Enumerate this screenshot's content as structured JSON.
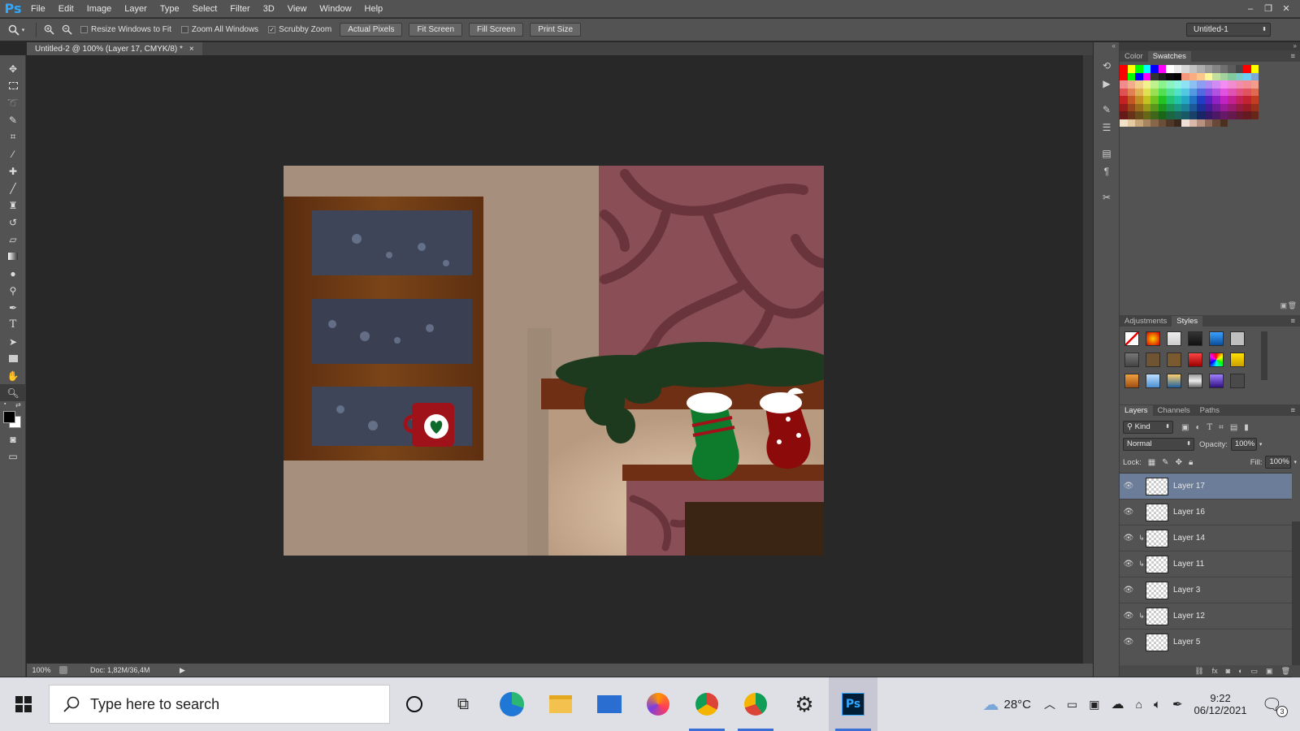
{
  "app": {
    "logo": "Ps"
  },
  "menu": [
    "File",
    "Edit",
    "Image",
    "Layer",
    "Type",
    "Select",
    "Filter",
    "3D",
    "View",
    "Window",
    "Help"
  ],
  "window_controls": {
    "minimize": "–",
    "restore": "❐",
    "close": "✕"
  },
  "options": {
    "resize_windows": "Resize Windows to Fit",
    "zoom_all": "Zoom All Windows",
    "scrubby_zoom": "Scrubby Zoom",
    "scrubby_checked": "✓",
    "actual_pixels": "Actual Pixels",
    "fit_screen": "Fit Screen",
    "fill_screen": "Fill Screen",
    "print_size": "Print Size",
    "workspace_doc": "Untitled-1"
  },
  "document": {
    "tab_title": "Untitled-2 @ 100% (Layer 17, CMYK/8) *",
    "tab_close": "×",
    "zoom": "100%",
    "doc_size": "Doc: 1,82M/36,4M"
  },
  "panels": {
    "color_tabs": [
      "Color",
      "Swatches"
    ],
    "adj_tabs": [
      "Adjustments",
      "Styles"
    ],
    "layer_tabs": [
      "Layers",
      "Channels",
      "Paths"
    ],
    "kind": "Kind",
    "blend_mode": "Normal",
    "opacity_label": "Opacity:",
    "opacity": "100%",
    "lock_label": "Lock:",
    "fill_label": "Fill:",
    "fill": "100%"
  },
  "layers": [
    {
      "name": "Layer 17",
      "selected": true,
      "clipped": false
    },
    {
      "name": "Layer 16",
      "selected": false,
      "clipped": false
    },
    {
      "name": "Layer 14",
      "selected": false,
      "clipped": true
    },
    {
      "name": "Layer 11",
      "selected": false,
      "clipped": true
    },
    {
      "name": "Layer 3",
      "selected": false,
      "clipped": false
    },
    {
      "name": "Layer 12",
      "selected": false,
      "clipped": true
    },
    {
      "name": "Layer 5",
      "selected": false,
      "clipped": false
    }
  ],
  "taskbar": {
    "search_placeholder": "Type here to search",
    "weather": "28°C",
    "time": "9:22",
    "date": "06/12/2021",
    "notifications": "3"
  },
  "colors": {
    "wall": "#a68f7d",
    "stone": "#8a4e56",
    "window_frame": "#6e3a14",
    "night_sky": "#3f4558",
    "garland": "#1d3a1f",
    "stocking_green": "#0e7a2c",
    "stocking_red": "#8c0a0a",
    "mug_red": "#a0121a"
  }
}
